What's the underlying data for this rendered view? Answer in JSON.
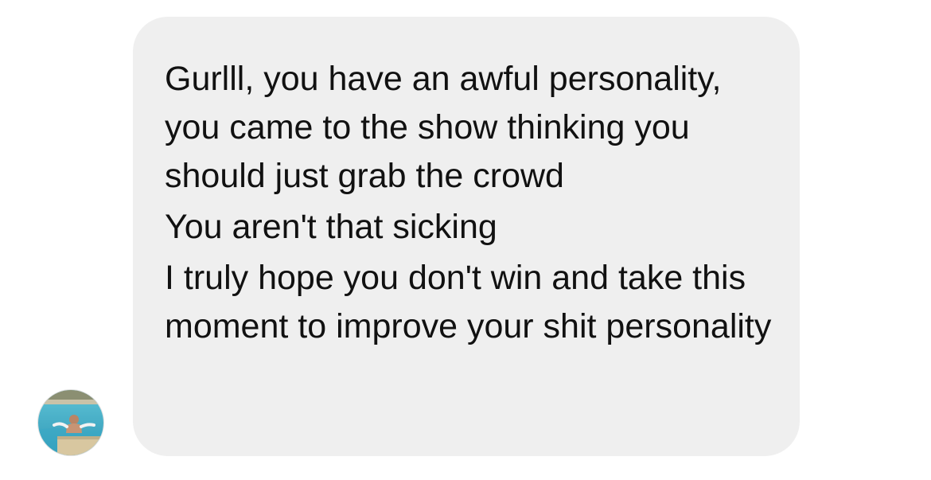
{
  "conversation": {
    "sender_avatar_icon": "avatar-photo-pool-icon",
    "bubble_color": "#efefef",
    "text_color": "#111111",
    "messages": [
      {
        "text": "Gurlll, you have an awful personality,  you came to the show thinking you should just grab the crowd"
      },
      {
        "text": "You aren't that sicking"
      },
      {
        "text": "I truly hope you don't win and take this moment to improve your shit personality"
      }
    ]
  }
}
